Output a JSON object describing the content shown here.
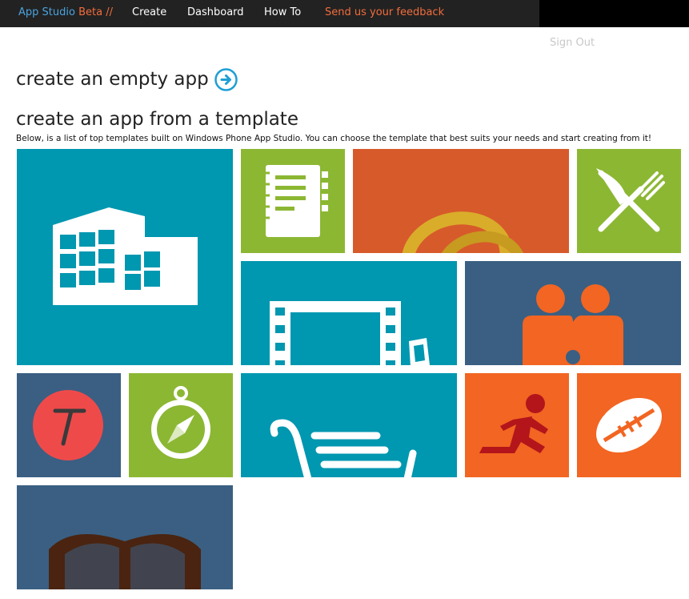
{
  "header": {
    "brand_name": "App Studio",
    "brand_beta": "Beta //",
    "nav": [
      "Create",
      "Dashboard",
      "How To"
    ],
    "feedback_link": "Send us your feedback",
    "sign_out": "Sign Out"
  },
  "main": {
    "empty_app_heading": "create an empty app",
    "template_heading": "create an app from a template",
    "description": "Below, is a list of top templates built on Windows Phone App Studio. You can choose the template that best suits your needs and start creating from it!"
  },
  "colors": {
    "teal": "#0097b0",
    "green": "#8cb733",
    "orange": "#f26522",
    "red_orange": "#d75a2b",
    "slate": "#3a5f82"
  },
  "templates": [
    {
      "icon": "building-icon",
      "color": "teal"
    },
    {
      "icon": "notebook-icon",
      "color": "green"
    },
    {
      "icon": "rings-icon",
      "color": "red_orange"
    },
    {
      "icon": "knife-fork-icon",
      "color": "green"
    },
    {
      "icon": "film-strip-icon",
      "color": "teal"
    },
    {
      "icon": "people-icon",
      "color": "slate"
    },
    {
      "icon": "letter-t-icon",
      "color": "slate"
    },
    {
      "icon": "compass-icon",
      "color": "green"
    },
    {
      "icon": "shopping-cart-icon",
      "color": "teal"
    },
    {
      "icon": "runner-icon",
      "color": "orange"
    },
    {
      "icon": "football-icon",
      "color": "orange"
    },
    {
      "icon": "book-icon",
      "color": "slate"
    }
  ]
}
